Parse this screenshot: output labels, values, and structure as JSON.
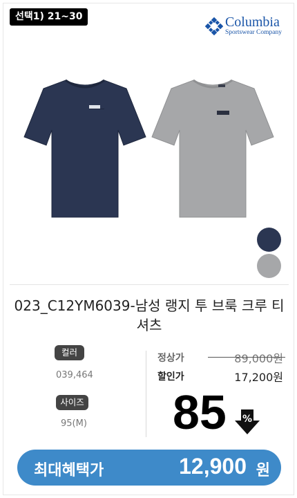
{
  "badge": {
    "label": "선택1) 21~30"
  },
  "brand": {
    "name": "Columbia",
    "tagline": "Sportswear Company",
    "color": "#1a55a8"
  },
  "product": {
    "title": "023_C12YM6039-남성 랭지 투 브룩 크루 티셔츠",
    "swatches": [
      {
        "name": "navy",
        "color": "#2b3652"
      },
      {
        "name": "grey",
        "color": "#a6a7a9"
      }
    ]
  },
  "options": {
    "color_label": "컬러",
    "color_value": "039,464",
    "size_label": "사이즈",
    "size_value": "95(M)"
  },
  "price": {
    "regular_label": "정상가",
    "regular_value": "89,000원",
    "sale_label": "할인가",
    "sale_value": "17,200원",
    "discount": "85",
    "discount_icon": "percent-down-arrow-icon"
  },
  "benefit": {
    "label": "최대혜택가",
    "amount": "12,900",
    "unit": "원",
    "color": "#3e8ac9"
  }
}
